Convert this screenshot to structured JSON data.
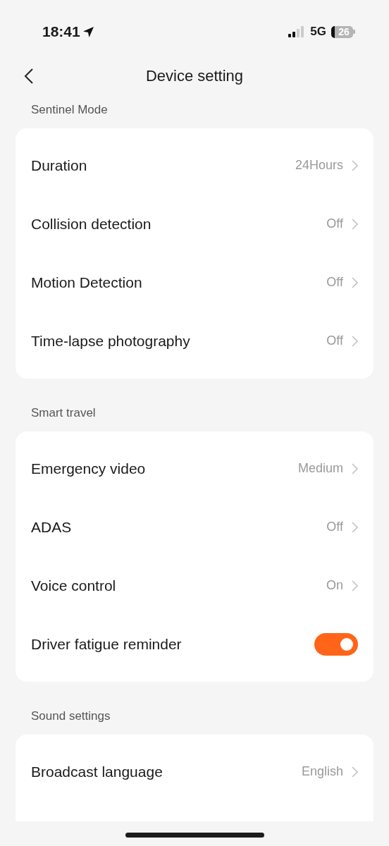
{
  "status_bar": {
    "time": "18:41",
    "network": "5G",
    "battery": "26"
  },
  "nav": {
    "title": "Device setting"
  },
  "sections": [
    {
      "title": "Sentinel Mode",
      "rows": [
        {
          "kind": "value",
          "label": "Duration",
          "value": "24Hours"
        },
        {
          "kind": "value",
          "label": "Collision detection",
          "value": "Off"
        },
        {
          "kind": "value",
          "label": "Motion Detection",
          "value": "Off"
        },
        {
          "kind": "value",
          "label": "Time-lapse photography",
          "value": "Off"
        }
      ]
    },
    {
      "title": "Smart travel",
      "rows": [
        {
          "kind": "value",
          "label": "Emergency video",
          "value": "Medium"
        },
        {
          "kind": "value",
          "label": "ADAS",
          "value": "Off"
        },
        {
          "kind": "value",
          "label": "Voice control",
          "value": "On"
        },
        {
          "kind": "toggle",
          "label": "Driver fatigue reminder",
          "on": true
        }
      ]
    },
    {
      "title": "Sound settings",
      "rows": [
        {
          "kind": "value",
          "label": "Broadcast language",
          "value": "English"
        }
      ]
    }
  ]
}
